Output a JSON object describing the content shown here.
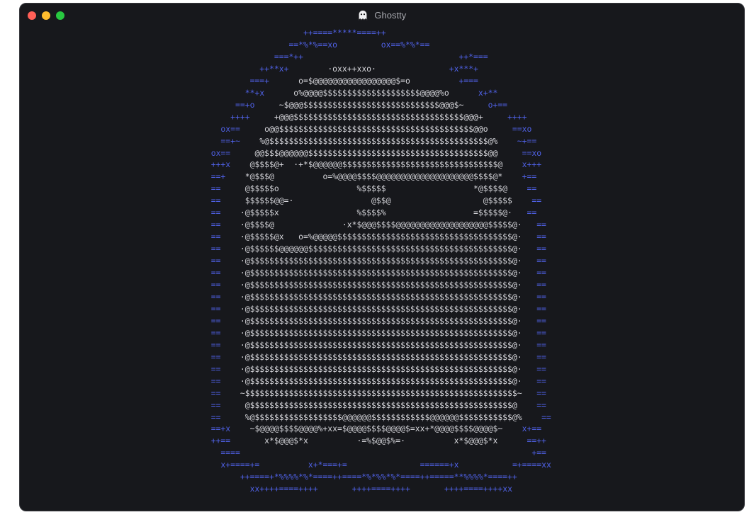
{
  "window": {
    "title": "Ghostty",
    "app_icon": "ghost-icon",
    "controls": [
      "close",
      "minimize",
      "zoom"
    ]
  },
  "colors": {
    "background": "#17181c",
    "border_art": "#4f61e6",
    "ghost_art": "#d7d7dc",
    "close": "#ff5f57",
    "minimize": "#febc2e",
    "zoom": "#28c840"
  },
  "terminal": {
    "art_lines": [
      [
        [
          "                     ++====*****====++",
          "b"
        ]
      ],
      [
        [
          "                  ==*%*%==xo         ox==%*%*==",
          "b"
        ]
      ],
      [
        [
          "               ===*++",
          "b"
        ],
        [
          "                                ",
          "w"
        ],
        [
          "++*===",
          "b"
        ]
      ],
      [
        [
          "            ++**x+",
          "b"
        ],
        [
          "        ·oxx++xxo·          ",
          "w"
        ],
        [
          "     +x***+",
          "b"
        ]
      ],
      [
        [
          "          ===+",
          "b"
        ],
        [
          "      o=$@@@@@@@@@@@@@@@@@$=o        ",
          "w"
        ],
        [
          "  +===",
          "b"
        ]
      ],
      [
        [
          "         **+x",
          "b"
        ],
        [
          "      o%@@@@$$$$$$$$$$$$$$$$$$$$@@@@%o      ",
          "w"
        ],
        [
          "x+**",
          "b"
        ]
      ],
      [
        [
          "       ==+o",
          "b"
        ],
        [
          "     ~$@@@$$$$$$$$$$$$$$$$$$$$$$$$$$$$@@@$~     ",
          "w"
        ],
        [
          "o+==",
          "b"
        ]
      ],
      [
        [
          "      ++++",
          "b"
        ],
        [
          "     +@@@$$$$$$$$$$$$$$$$$$$$$$$$$$$$$$$$$$$@@@+     ",
          "w"
        ],
        [
          "++++",
          "b"
        ]
      ],
      [
        [
          "    ox==",
          "b"
        ],
        [
          "     o@@$$$$$$$$$$$$$$$$$$$$$$$$$$$$$$$$$$$$$$$$@@o     ",
          "w"
        ],
        [
          "==xo",
          "b"
        ]
      ],
      [
        [
          "    ==+~",
          "b"
        ],
        [
          "    %@$$$$$$$$$$$$$$$$$$$$$$$$$$$$$$$$$$$$$$$$$$$$$@%    ",
          "w"
        ],
        [
          "~+==",
          "b"
        ]
      ],
      [
        [
          "  ox==",
          "b"
        ],
        [
          "     @@$$$@@@@@@$$$$$$$$$$$$$$$$$$$$$$$$$$$$$$$$$$$$$@@     ",
          "w"
        ],
        [
          "==xo",
          "b"
        ]
      ],
      [
        [
          "  +++x",
          "b"
        ],
        [
          "    @$$$$@+  ·+*$@@@@@@$$$$$$$$$$$$$$$$$$$$$$$$$$$$$$$$@    ",
          "w"
        ],
        [
          "x+++",
          "b"
        ]
      ],
      [
        [
          "  ==+",
          "b"
        ],
        [
          "    *@$$$@          o=%@@@@$$$$@@@@@@@@@@@@@@@@@@@@$$$$@*    ",
          "w"
        ],
        [
          "+==",
          "b"
        ]
      ],
      [
        [
          "  ==",
          "b"
        ],
        [
          "     @$$$$$o                %$$$$$                  *@$$$$@    ",
          "w"
        ],
        [
          "==",
          "b"
        ]
      ],
      [
        [
          "  ==",
          "b"
        ],
        [
          "     $$$$$$@@=·                @$$@                   @$$$$$    ",
          "w"
        ],
        [
          "==",
          "b"
        ]
      ],
      [
        [
          "  ==",
          "b"
        ],
        [
          "    ·@$$$$$x                %$$$$%                  =$$$$$@·   ",
          "w"
        ],
        [
          "==",
          "b"
        ]
      ],
      [
        [
          "  ==",
          "b"
        ],
        [
          "    ·@$$$$@              ·x*$@@@$$$$@@@@@@@@@@@@@@@@@@@$$$$$@·   ",
          "w"
        ],
        [
          "==",
          "b"
        ]
      ],
      [
        [
          "  ==",
          "b"
        ],
        [
          "    ·@$$$$$@x   o=%@@@@@$$$$$$$$$$$$$$$$$$$$$$$$$$$$$$$$$$$$@·   ",
          "w"
        ],
        [
          "==",
          "b"
        ]
      ],
      [
        [
          "  ==",
          "b"
        ],
        [
          "    ·@$$$$$$@@@@@@$$$$$$$$$$$$$$$$$$$$$$$$$$$$$$$$$$$$$$$$$$@·   ",
          "w"
        ],
        [
          "==",
          "b"
        ]
      ],
      [
        [
          "  ==",
          "b"
        ],
        [
          "    ·@$$$$$$$$$$$$$$$$$$$$$$$$$$$$$$$$$$$$$$$$$$$$$$$$$$$$$$@·   ",
          "w"
        ],
        [
          "==",
          "b"
        ]
      ],
      [
        [
          "  ==",
          "b"
        ],
        [
          "    ·@$$$$$$$$$$$$$$$$$$$$$$$$$$$$$$$$$$$$$$$$$$$$$$$$$$$$$$@·   ",
          "w"
        ],
        [
          "==",
          "b"
        ]
      ],
      [
        [
          "  ==",
          "b"
        ],
        [
          "    ·@$$$$$$$$$$$$$$$$$$$$$$$$$$$$$$$$$$$$$$$$$$$$$$$$$$$$$$@·   ",
          "w"
        ],
        [
          "==",
          "b"
        ]
      ],
      [
        [
          "  ==",
          "b"
        ],
        [
          "    ·@$$$$$$$$$$$$$$$$$$$$$$$$$$$$$$$$$$$$$$$$$$$$$$$$$$$$$$@·   ",
          "w"
        ],
        [
          "==",
          "b"
        ]
      ],
      [
        [
          "  ==",
          "b"
        ],
        [
          "    ·@$$$$$$$$$$$$$$$$$$$$$$$$$$$$$$$$$$$$$$$$$$$$$$$$$$$$$$@·   ",
          "w"
        ],
        [
          "==",
          "b"
        ]
      ],
      [
        [
          "  ==",
          "b"
        ],
        [
          "    ·@$$$$$$$$$$$$$$$$$$$$$$$$$$$$$$$$$$$$$$$$$$$$$$$$$$$$$$@·   ",
          "w"
        ],
        [
          "==",
          "b"
        ]
      ],
      [
        [
          "  ==",
          "b"
        ],
        [
          "    ·@$$$$$$$$$$$$$$$$$$$$$$$$$$$$$$$$$$$$$$$$$$$$$$$$$$$$$$@·   ",
          "w"
        ],
        [
          "==",
          "b"
        ]
      ],
      [
        [
          "  ==",
          "b"
        ],
        [
          "    ·@$$$$$$$$$$$$$$$$$$$$$$$$$$$$$$$$$$$$$$$$$$$$$$$$$$$$$$@·   ",
          "w"
        ],
        [
          "==",
          "b"
        ]
      ],
      [
        [
          "  ==",
          "b"
        ],
        [
          "    ·@$$$$$$$$$$$$$$$$$$$$$$$$$$$$$$$$$$$$$$$$$$$$$$$$$$$$$$@·   ",
          "w"
        ],
        [
          "==",
          "b"
        ]
      ],
      [
        [
          "  ==",
          "b"
        ],
        [
          "    ·@$$$$$$$$$$$$$$$$$$$$$$$$$$$$$$$$$$$$$$$$$$$$$$$$$$$$$$@·   ",
          "w"
        ],
        [
          "==",
          "b"
        ]
      ],
      [
        [
          "  ==",
          "b"
        ],
        [
          "    ·@$$$$$$$$$$$$$$$$$$$$$$$$$$$$$$$$$$$$$$$$$$$$$$$$$$$$$$@·   ",
          "w"
        ],
        [
          "==",
          "b"
        ]
      ],
      [
        [
          "  ==",
          "b"
        ],
        [
          "    ~$$$$$$$$$$$$$$$$$$$$$$$$$$$$$$$$$$$$$$$$$$$$$$$$$$$$$$$$~   ",
          "w"
        ],
        [
          "==",
          "b"
        ]
      ],
      [
        [
          "  ==",
          "b"
        ],
        [
          "     @$$$$$$$$$$$$$$$$$$$$$$$$$$$$$$$$$$$$$$$$$$$$$$$$$$$$$$@    ",
          "w"
        ],
        [
          "==",
          "b"
        ]
      ],
      [
        [
          "  ==",
          "b"
        ],
        [
          "     %@$$$$$$$$$$$$$$$$$$@@@@@@$$$$$$$$$$$$@@@@@@$$$$$$$$$$$@%    ",
          "w"
        ],
        [
          "==",
          "b"
        ]
      ],
      [
        [
          "  ==+x",
          "b"
        ],
        [
          "    ~$@@@@$$$$@@@@%+xx=$@@@@$$$$@@@@$=xx+*@@@@$$$$@@@@$~    ",
          "w"
        ],
        [
          "x+==",
          "b"
        ]
      ],
      [
        [
          "  ++==",
          "b"
        ],
        [
          "       x*$@@@$*x          ·=%$@@$%=·          x*$@@@$*x      ",
          "w"
        ],
        [
          "==++",
          "b"
        ]
      ],
      [
        [
          "    ====",
          "b"
        ],
        [
          "                                                            ",
          "w"
        ],
        [
          "+==",
          "b"
        ]
      ],
      [
        [
          "    x+====+=",
          "b"
        ],
        [
          "          ",
          "w"
        ],
        [
          "x+*===+=",
          "b"
        ],
        [
          "               ",
          "w"
        ],
        [
          "======+x",
          "b"
        ],
        [
          "           ",
          "w"
        ],
        [
          "=+====xx",
          "b"
        ]
      ],
      [
        [
          "        ++====+*%%%%*%*====++====*%*%%*%*====++=====**%%%%*====++",
          "b"
        ]
      ],
      [
        [
          "          xx++++====++++",
          "b"
        ],
        [
          "       ",
          "w"
        ],
        [
          "++++====++++",
          "b"
        ],
        [
          "       ",
          "w"
        ],
        [
          "++++====++++xx",
          "b"
        ]
      ]
    ]
  }
}
